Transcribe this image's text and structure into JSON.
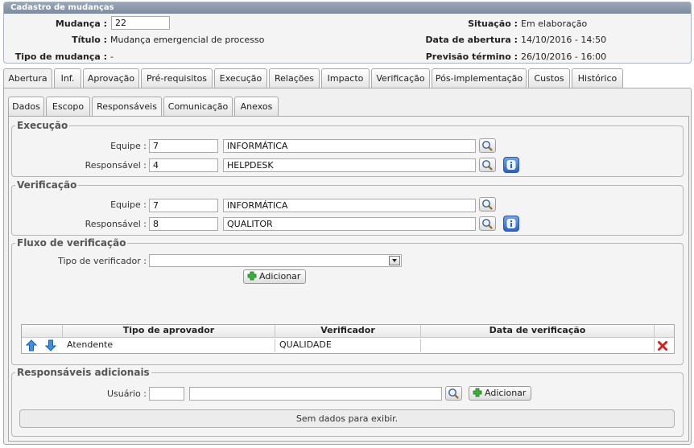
{
  "header": {
    "title": "Cadastro de mudanças",
    "mudanca_label": "Mudança :",
    "mudanca_value": "22",
    "titulo_label": "Título :",
    "titulo_value": "Mudança emergencial de processo",
    "tipo_label": "Tipo de mudança :",
    "tipo_value": "-",
    "situacao_label": "Situação :",
    "situacao_value": "Em elaboração",
    "abertura_label": "Data de abertura :",
    "abertura_value": "14/10/2016 - 14:50",
    "previsao_label": "Previsão término :",
    "previsao_value": "26/10/2016 - 16:00"
  },
  "tabs": [
    "Abertura",
    "Inf.",
    "Aprovação",
    "Pré-requisitos",
    "Execução",
    "Relações",
    "Impacto",
    "Verificação",
    "Pós-implementação",
    "Custos",
    "Histórico"
  ],
  "subtabs": [
    "Dados",
    "Escopo",
    "Responsáveis",
    "Comunicação",
    "Anexos"
  ],
  "execucao": {
    "title": "Execução",
    "equipe_label": "Equipe :",
    "equipe_code": "7",
    "equipe_name": "INFORMÁTICA",
    "resp_label": "Responsável :",
    "resp_code": "4",
    "resp_name": "HELPDESK"
  },
  "verificacao": {
    "title": "Verificação",
    "equipe_label": "Equipe :",
    "equipe_code": "7",
    "equipe_name": "INFORMÁTICA",
    "resp_label": "Responsável :",
    "resp_code": "8",
    "resp_name": "QUALITOR"
  },
  "fluxo": {
    "title": "Fluxo de verificação",
    "tipo_label": "Tipo de verificador :",
    "tipo_value": "",
    "add_label": "Adicionar",
    "columns": [
      "Tipo de aprovador",
      "Verificador",
      "Data de verificação"
    ],
    "rows": [
      {
        "tipo": "Atendente",
        "verificador": "QUALIDADE",
        "data": ""
      }
    ]
  },
  "adicionais": {
    "title": "Responsáveis adicionais",
    "usuario_label": "Usuário :",
    "usuario_code": "",
    "usuario_name": "",
    "add_label": "Adicionar",
    "empty_text": "Sem dados para exibir."
  },
  "icons": {
    "lookup": "magnifier-icon",
    "info": "info-icon",
    "add": "plus-icon",
    "up": "arrow-up-icon",
    "down": "arrow-down-icon",
    "delete": "delete-icon",
    "dropdown": "chevron-down-icon"
  },
  "colors": {
    "header_bar": "#8796ab",
    "add_green": "#2e9e2e",
    "delete_red": "#d42020",
    "arrow_blue": "#2b7fd6"
  }
}
